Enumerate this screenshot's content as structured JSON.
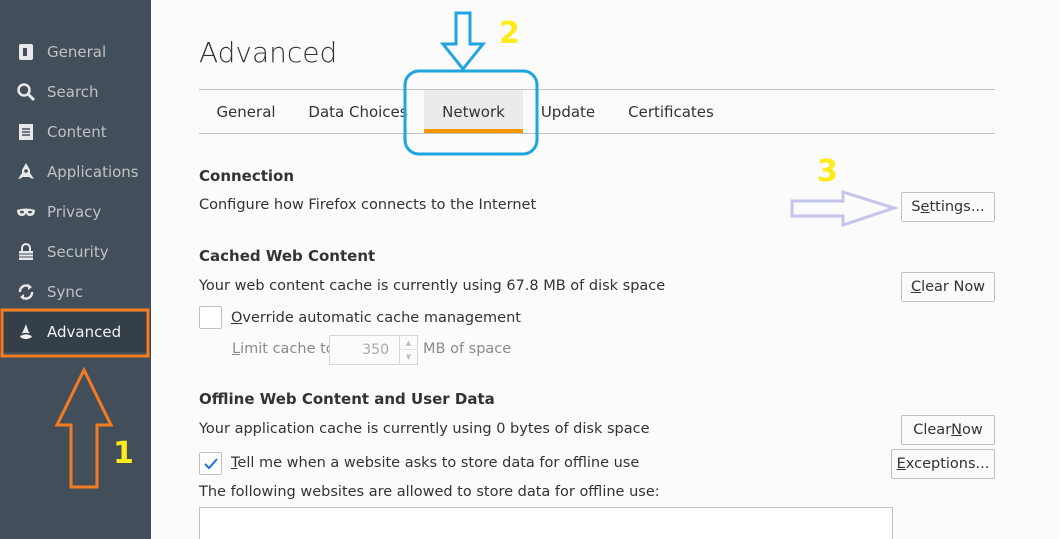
{
  "sidebar": {
    "items": [
      {
        "label": "General",
        "icon": "general-icon"
      },
      {
        "label": "Search",
        "icon": "search-icon"
      },
      {
        "label": "Content",
        "icon": "content-icon"
      },
      {
        "label": "Applications",
        "icon": "applications-icon"
      },
      {
        "label": "Privacy",
        "icon": "privacy-icon"
      },
      {
        "label": "Security",
        "icon": "security-icon"
      },
      {
        "label": "Sync",
        "icon": "sync-icon"
      },
      {
        "label": "Advanced",
        "icon": "advanced-icon",
        "active": true
      }
    ]
  },
  "main": {
    "title": "Advanced",
    "tabs": [
      {
        "label": "General"
      },
      {
        "label": "Data Choices"
      },
      {
        "label": "Network",
        "selected": true
      },
      {
        "label": "Update"
      },
      {
        "label": "Certificates"
      }
    ],
    "connection": {
      "heading": "Connection",
      "description": "Configure how Firefox connects to the Internet",
      "settings_button": {
        "pre": "S",
        "accel": "e",
        "post": "ttings..."
      }
    },
    "cached": {
      "heading": "Cached Web Content",
      "description": "Your web content cache is currently using 67.8 MB of disk space",
      "clear_button": {
        "pre": "",
        "accel": "C",
        "post": "lear Now"
      },
      "override_checkbox": {
        "checked": false,
        "pre": "",
        "accel": "O",
        "post": "verride automatic cache management"
      },
      "limit_label": {
        "pre": "",
        "accel": "L",
        "post": "imit cache to"
      },
      "limit_value": "350",
      "limit_unit": "MB of space"
    },
    "offline": {
      "heading": "Offline Web Content and User Data",
      "description": "Your application cache is currently using 0 bytes of disk space",
      "clear_button": {
        "pre": "Clear ",
        "accel": "N",
        "post": "ow"
      },
      "tell_checkbox": {
        "checked": true,
        "pre": "",
        "accel": "T",
        "post": "ell me when a website asks to store data for offline use"
      },
      "exceptions_button": {
        "pre": "",
        "accel": "E",
        "post": "xceptions..."
      },
      "list_label": "The following websites are allowed to store data for offline use:"
    }
  },
  "annotations": {
    "step1": "1",
    "step2": "2",
    "step3": "3",
    "colors": {
      "orange": "#f47b20",
      "blue": "#1ea5e0",
      "lavender": "#c5c5ec",
      "yellow": "#ffeb1a"
    }
  }
}
